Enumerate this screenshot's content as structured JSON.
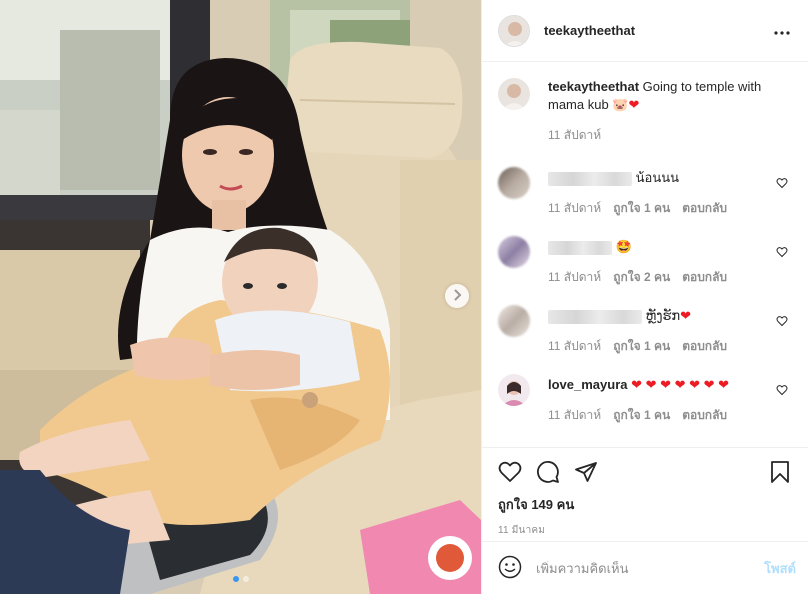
{
  "post": {
    "username": "teekaytheethat",
    "caption": "Going to temple with mama kub",
    "caption_emoji": "🐷",
    "caption_heart": "❤",
    "caption_time": "11 สัปดาห์",
    "likes_text": "ถูกใจ 149 คน",
    "date": "11 มีนาคม",
    "carousel_total": 2,
    "carousel_active": 1
  },
  "comments": [
    {
      "text": "น้อนนน",
      "meta": {
        "time": "11 สัปดาห์",
        "likes": "ถูกใจ 1 คน",
        "reply": "ตอบกลับ"
      }
    },
    {
      "text": "🤩",
      "meta": {
        "time": "11 สัปดาห์",
        "likes": "ถูกใจ 2 คน",
        "reply": "ตอบกลับ"
      }
    },
    {
      "text": "ຫຼັງຮັກ",
      "heart": "❤",
      "meta": {
        "time": "11 สัปดาห์",
        "likes": "ถูกใจ 1 คน",
        "reply": "ตอบกลับ"
      }
    },
    {
      "username": "love_mayura",
      "text": "❤ ❤ ❤ ❤ ❤ ❤ ❤",
      "meta": {
        "time": "11 สัปดาห์",
        "likes": "ถูกใจ 1 คน",
        "reply": "ตอบกลับ"
      }
    }
  ],
  "add_comment": {
    "placeholder": "เพิ่มความคิดเห็น",
    "post_label": "โพสต์"
  },
  "icons": {
    "more": "more-options-icon",
    "like": "heart-icon",
    "comment": "comment-icon",
    "share": "share-icon",
    "save": "bookmark-icon",
    "emoji": "emoji-icon",
    "next": "chevron-right-icon"
  },
  "colors": {
    "text": "#262626",
    "muted": "#8e8e8e",
    "border": "#efefef",
    "link_blue": "#3897f0",
    "post_disabled": "#b2dffc",
    "heart_red": "#ed1c24"
  }
}
